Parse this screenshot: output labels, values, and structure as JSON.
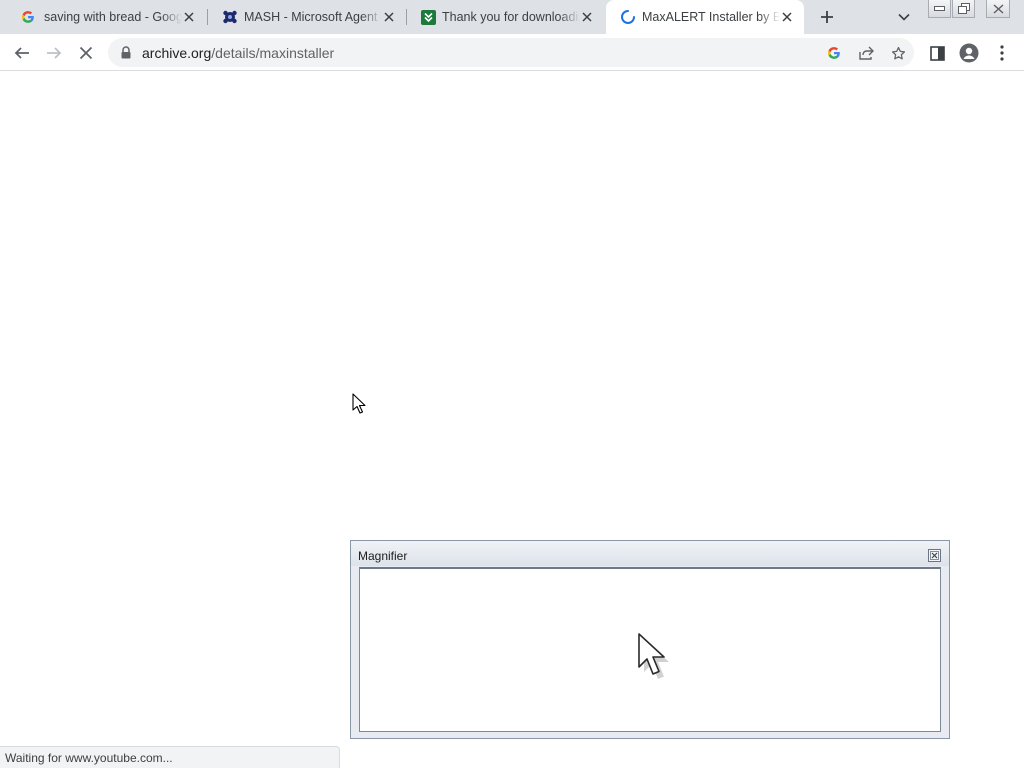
{
  "tabs": [
    {
      "title": "saving with bread - Google Search",
      "favicon": "google-g-icon",
      "active": false
    },
    {
      "title": "MASH - Microsoft Agent Scripting Helper",
      "favicon": "mash-icon",
      "active": false
    },
    {
      "title": "Thank you for downloading",
      "favicon": "download-site-icon",
      "active": false
    },
    {
      "title": "MaxALERT Installer by BonziBUDDY",
      "favicon": "loading-spinner-icon",
      "active": true
    }
  ],
  "toolbar": {
    "url_domain": "archive.org",
    "url_path": "/details/maxinstaller"
  },
  "magnifier": {
    "title": "Magnifier"
  },
  "status": {
    "text": "Waiting for www.youtube.com..."
  },
  "colors": {
    "tabstrip": "#dee1e6",
    "omnibox": "#f1f3f4",
    "magnifier_frame": "#e8ecf2"
  }
}
